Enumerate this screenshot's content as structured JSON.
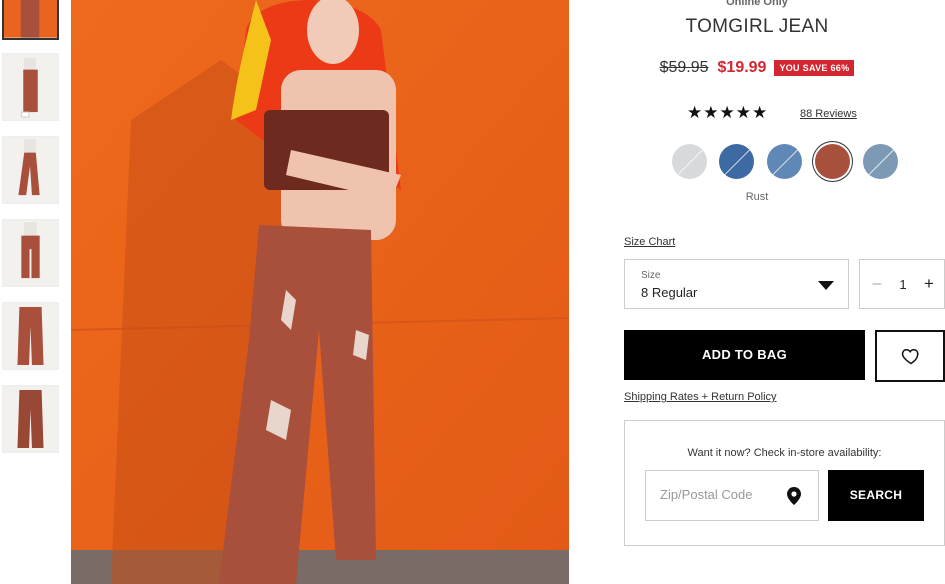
{
  "thumbnails": [
    {
      "label": "Model front, cropped",
      "active": true
    },
    {
      "label": "Model side view"
    },
    {
      "label": "Model walking"
    },
    {
      "label": "Model back view"
    },
    {
      "label": "Jeans flat lay front"
    },
    {
      "label": "Jeans flat lay back"
    }
  ],
  "product": {
    "badge": "Online Only",
    "title": "TOMGIRL JEAN",
    "original_price": "$59.95",
    "sale_price": "$19.99",
    "save_badge": "YOU SAVE 66%",
    "stars": "★★★★★",
    "reviews_label": "88 Reviews",
    "selected_color": "Rust"
  },
  "swatches": [
    {
      "name": "light-stripe",
      "color": "#d7dadd"
    },
    {
      "name": "dark-wash",
      "color": "#3d6aa3"
    },
    {
      "name": "medium-wash",
      "color": "#5f88b6"
    },
    {
      "name": "rust",
      "color": "#a8503c",
      "selected": true
    },
    {
      "name": "light-wash",
      "color": "#7c9ab3"
    }
  ],
  "size": {
    "chart_link": "Size Chart",
    "label": "Size",
    "value": "8 Regular"
  },
  "quantity": {
    "minus": "–",
    "value": "1",
    "plus": "+"
  },
  "actions": {
    "add_to_bag": "ADD TO BAG",
    "shipping_link": "Shipping Rates + Return Policy"
  },
  "instore": {
    "label": "Want it now? Check in-store availability:",
    "zip_placeholder": "Zip/Postal Code",
    "search_label": "SEARCH"
  },
  "colors": {
    "sale_red": "#d22630",
    "background_orange": "#e9651f",
    "jean_rust": "#a8503c"
  }
}
